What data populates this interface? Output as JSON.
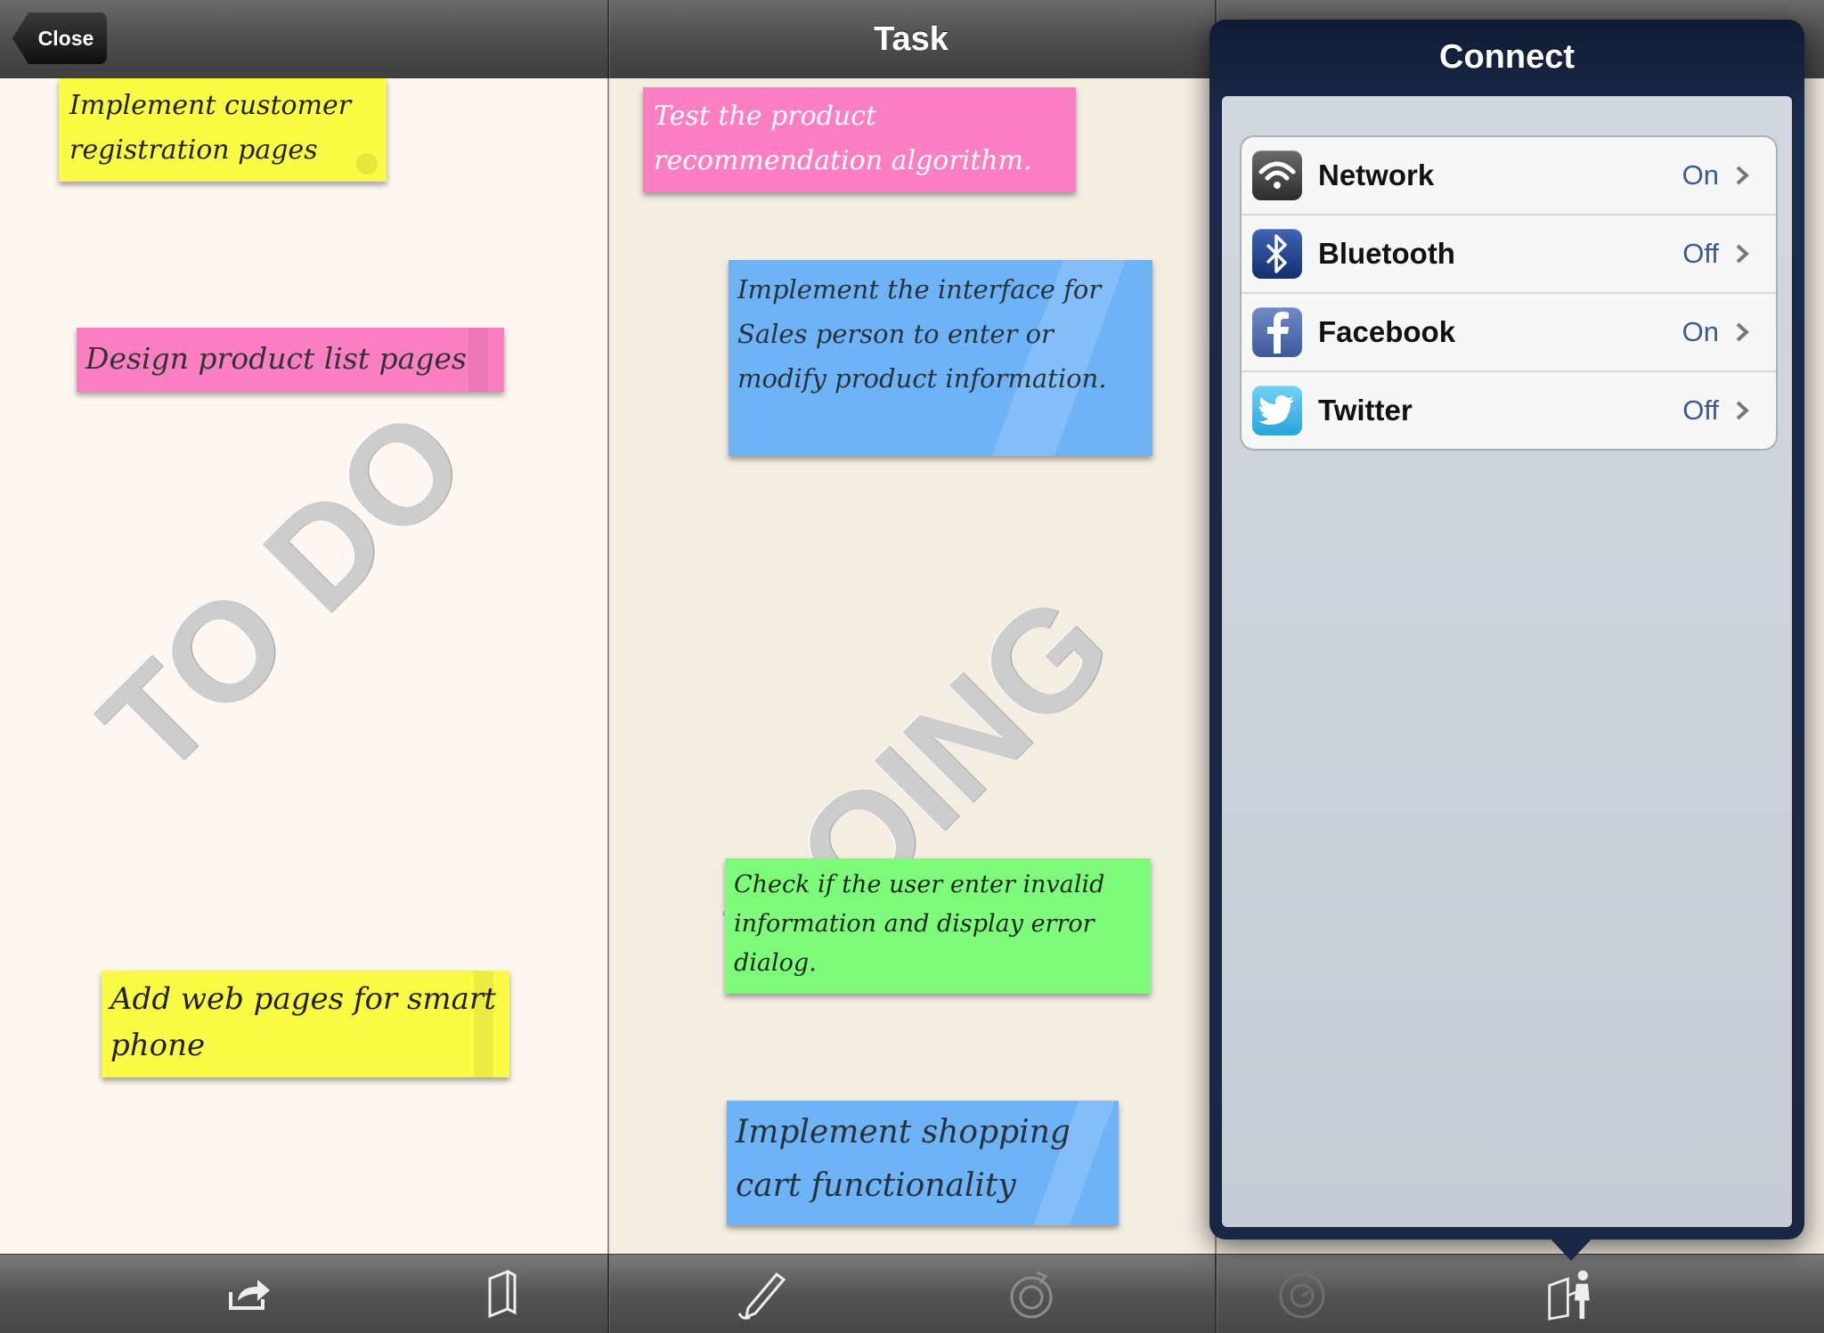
{
  "header": {
    "close_label": "Close",
    "title": "Task"
  },
  "columns": {
    "todo": {
      "watermark": "TO DO"
    },
    "doing": {
      "watermark": "DOING"
    }
  },
  "notes": {
    "todo": [
      {
        "text": "Implement customer registration pages",
        "color": "#fafb45"
      },
      {
        "text": "Design product list pages",
        "color": "#fb7fc2"
      },
      {
        "text": "Add web pages for smart phone",
        "color": "#fafb45"
      }
    ],
    "doing": [
      {
        "text": "Test the product recommendation algorithm.",
        "color": "#fb7fc2"
      },
      {
        "text": "Implement the interface for Sales person to enter or modify product information.",
        "color": "#6fb3f7"
      },
      {
        "text": "Check if the user enter invalid information and display error dialog.",
        "color": "#7efb7a"
      },
      {
        "text": "Implement shopping cart functionality",
        "color": "#6fb3f7"
      }
    ]
  },
  "connect": {
    "title": "Connect",
    "items": [
      {
        "label": "Network",
        "value": "On",
        "icon": "wifi-icon"
      },
      {
        "label": "Bluetooth",
        "value": "Off",
        "icon": "bluetooth-icon"
      },
      {
        "label": "Facebook",
        "value": "On",
        "icon": "facebook-icon"
      },
      {
        "label": "Twitter",
        "value": "Off",
        "icon": "twitter-icon"
      }
    ]
  },
  "toolbar": {
    "icons": [
      "share-icon",
      "book-icon",
      "pen-icon",
      "timer-icon",
      "sync-icon",
      "exit-icon"
    ]
  }
}
